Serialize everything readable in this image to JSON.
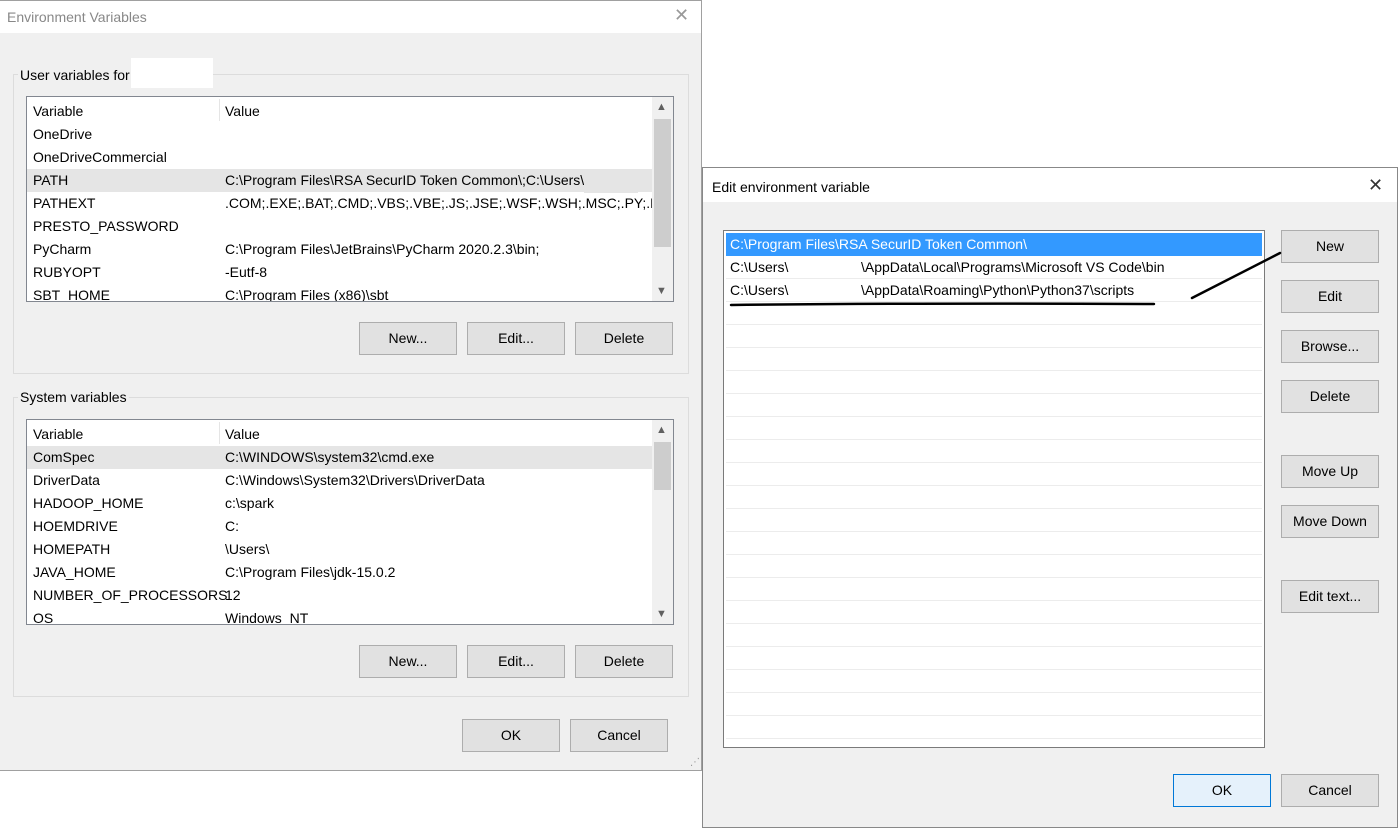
{
  "env_dialog": {
    "title": "Environment Variables",
    "user_group_label": "User variables for",
    "system_group_label": "System variables",
    "columns": {
      "variable": "Variable",
      "value": "Value"
    },
    "user_rows": [
      {
        "name": "OneDrive",
        "value": ""
      },
      {
        "name": "OneDriveCommercial",
        "value": ""
      },
      {
        "name": "PATH",
        "value": "C:\\Program Files\\RSA SecurID Token Common\\;C:\\Users\\"
      },
      {
        "name": "PATHEXT",
        "value": ".COM;.EXE;.BAT;.CMD;.VBS;.VBE;.JS;.JSE;.WSF;.WSH;.MSC;.PY;.PYW..."
      },
      {
        "name": "PRESTO_PASSWORD",
        "value": ""
      },
      {
        "name": "PyCharm",
        "value": "C:\\Program Files\\JetBrains\\PyCharm 2020.2.3\\bin;"
      },
      {
        "name": "RUBYOPT",
        "value": "-Eutf-8"
      },
      {
        "name": "SBT_HOME",
        "value": "C:\\Program Files (x86)\\sbt"
      }
    ],
    "system_rows": [
      {
        "name": "ComSpec",
        "value": "C:\\WINDOWS\\system32\\cmd.exe"
      },
      {
        "name": "DriverData",
        "value": "C:\\Windows\\System32\\Drivers\\DriverData"
      },
      {
        "name": "HADOOP_HOME",
        "value": "c:\\spark"
      },
      {
        "name": "HOEMDRIVE",
        "value": "C:"
      },
      {
        "name": "HOMEPATH",
        "value": "\\Users\\"
      },
      {
        "name": "JAVA_HOME",
        "value": "C:\\Program Files\\jdk-15.0.2"
      },
      {
        "name": "NUMBER_OF_PROCESSORS",
        "value": "12"
      },
      {
        "name": "OS",
        "value": "Windows_NT"
      }
    ],
    "user_buttons": {
      "new": "New...",
      "edit": "Edit...",
      "delete": "Delete"
    },
    "system_buttons": {
      "new": "New...",
      "edit": "Edit...",
      "delete": "Delete"
    },
    "ok": "OK",
    "cancel": "Cancel"
  },
  "edit_dialog": {
    "title": "Edit environment variable",
    "entries": [
      {
        "prefix": "C:\\Program Files\\RSA SecurID Token Common\\",
        "suffix": ""
      },
      {
        "prefix": "C:\\Users\\",
        "suffix": "\\AppData\\Local\\Programs\\Microsoft VS Code\\bin"
      },
      {
        "prefix": "C:\\Users\\",
        "suffix": "\\AppData\\Roaming\\Python\\Python37\\scripts"
      }
    ],
    "buttons": {
      "new": "New",
      "edit": "Edit",
      "browse": "Browse...",
      "delete": "Delete",
      "move_up": "Move Up",
      "move_down": "Move Down",
      "edit_text": "Edit text..."
    },
    "ok": "OK",
    "cancel": "Cancel"
  },
  "colors": {
    "selection": "#3399ff",
    "dialog_bg": "#f0f0f0",
    "annotation": "#000000"
  }
}
